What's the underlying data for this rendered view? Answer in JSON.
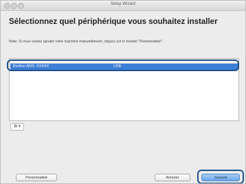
{
  "window": {
    "title": "Setup Wizard"
  },
  "heading": "Sélectionnez quel périphérique vous souhaitez installer",
  "note": "Note: Si vous voulez ajouter votre machine manuellement, cliquez sur le bouton \"Personnalisé\".",
  "device_list": {
    "rows": [
      {
        "name": "Brother ADS- XXXXX",
        "connection": "USB",
        "selected": true
      }
    ]
  },
  "gear_menu": {
    "label": "✿ ▾",
    "icon": "gear-icon"
  },
  "buttons": {
    "custom": "Personnalisé",
    "cancel": "Annuler",
    "next": "Suivant"
  },
  "colors": {
    "selection": "#3e7fd6",
    "highlight_outline": "#1d4f8a",
    "default_button": "#6aa6e8"
  }
}
